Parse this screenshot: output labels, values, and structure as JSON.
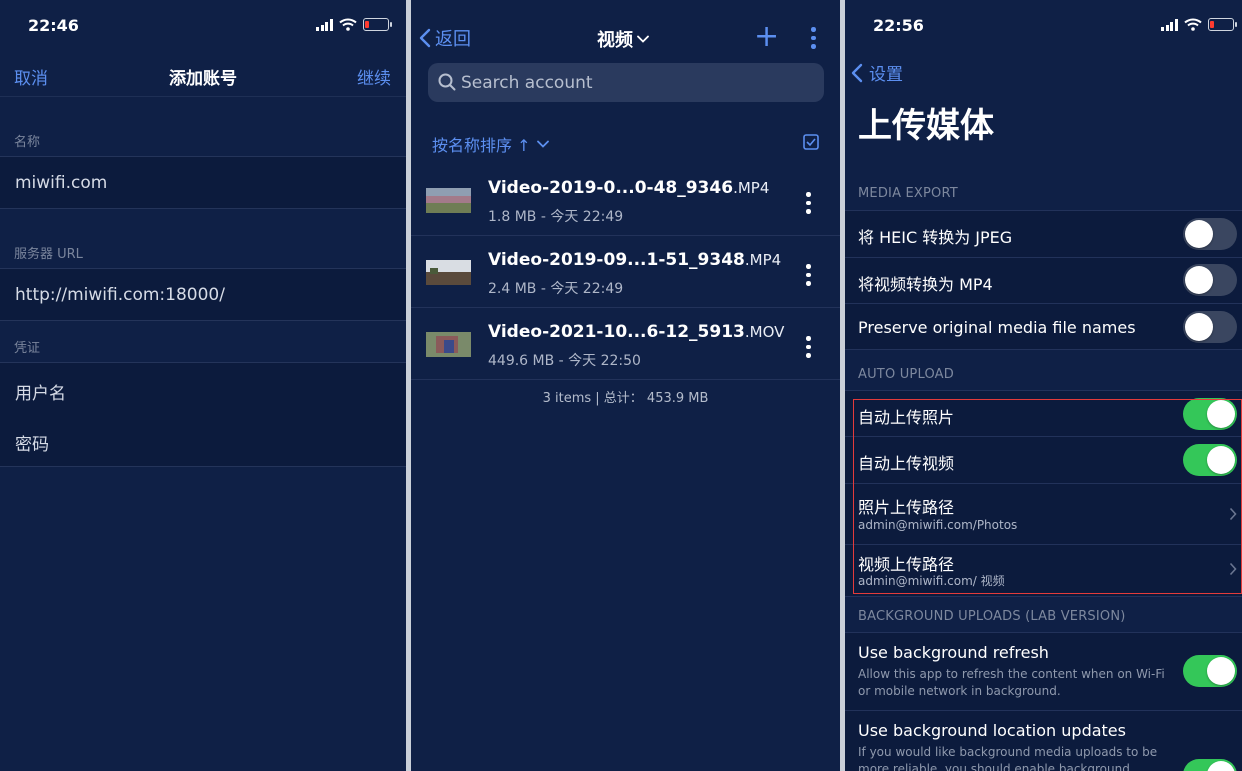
{
  "colors": {
    "bg": "#0f2046",
    "accent": "#5c8ff0",
    "toggle_on": "#34c759",
    "highlight": "#e33b3b"
  },
  "panel1": {
    "time": "22:46",
    "nav": {
      "cancel": "取消",
      "title": "添加账号",
      "continue": "继续"
    },
    "name_label": "名称",
    "name_value": "miwifi.com",
    "url_label": "服务器 URL",
    "url_value": "http://miwifi.com:18000/",
    "cred_label": "凭证",
    "username_placeholder": "用户名",
    "password_placeholder": "密码"
  },
  "panel2": {
    "nav": {
      "back": "返回",
      "title": "视频"
    },
    "search_placeholder": "Search account",
    "sort_label": "按名称排序 ↑",
    "files": [
      {
        "name": "Video-2019-0...0-48_9346",
        "ext": ".MP4",
        "meta": "1.8 MB - 今天 22:49"
      },
      {
        "name": "Video-2019-09...1-51_9348",
        "ext": ".MP4",
        "meta": "2.4 MB - 今天 22:49"
      },
      {
        "name": "Video-2021-10...6-12_5913",
        "ext": ".MOV",
        "meta": "449.6 MB - 今天 22:50"
      }
    ],
    "footer": "3 items | 总计： 453.9 MB"
  },
  "panel3": {
    "time": "22:56",
    "back": "设置",
    "title": "上传媒体",
    "media_export": {
      "header": "MEDIA EXPORT",
      "heic": "将 HEIC 转换为 JPEG",
      "mp4": "将视频转换为 MP4",
      "preserve": "Preserve original media file names"
    },
    "auto_upload": {
      "header": "AUTO UPLOAD",
      "photos": "自动上传照片",
      "videos": "自动上传视频",
      "photo_path_label": "照片上传路径",
      "photo_path_value": "admin@miwifi.com/Photos",
      "video_path_label": "视频上传路径",
      "video_path_value": "admin@miwifi.com/ 视频"
    },
    "background": {
      "header": "BACKGROUND UPLOADS (LAB VERSION)",
      "refresh_label": "Use background refresh",
      "refresh_desc": "Allow this app to refresh the content when on Wi-Fi or mobile network in background.",
      "location_label": "Use background location updates",
      "location_desc": "If you would like background media uploads to be more reliable, you should enable background"
    },
    "toggles": {
      "heic": false,
      "mp4": false,
      "preserve": false,
      "photos": true,
      "videos": true,
      "refresh": true,
      "location": true
    }
  }
}
